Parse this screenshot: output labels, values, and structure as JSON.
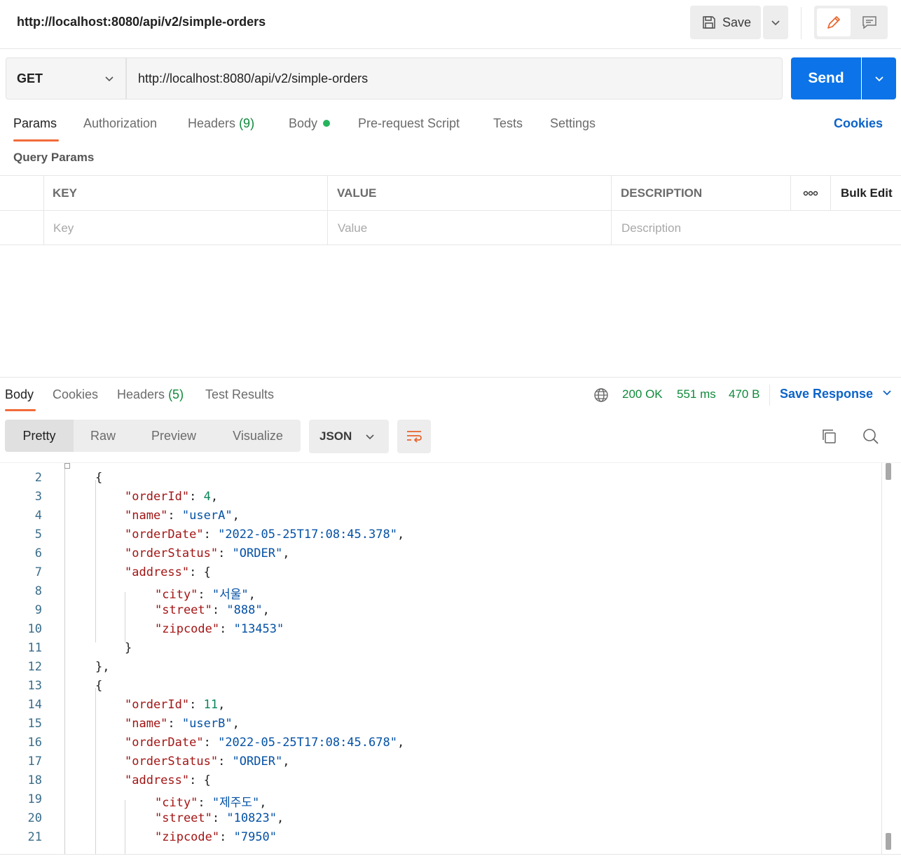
{
  "header": {
    "title": "http://localhost:8080/api/v2/simple-orders",
    "save_label": "Save"
  },
  "request": {
    "method": "GET",
    "url": "http://localhost:8080/api/v2/simple-orders",
    "send_label": "Send"
  },
  "req_tabs": {
    "params": "Params",
    "authorization": "Authorization",
    "headers": "Headers",
    "headers_count": "(9)",
    "body": "Body",
    "prerequest": "Pre-request Script",
    "tests": "Tests",
    "settings": "Settings",
    "cookies": "Cookies"
  },
  "query_params": {
    "title": "Query Params",
    "columns": {
      "key": "KEY",
      "value": "VALUE",
      "description": "DESCRIPTION",
      "bulk_edit": "Bulk Edit"
    },
    "placeholders": {
      "key": "Key",
      "value": "Value",
      "description": "Description"
    }
  },
  "response": {
    "tabs": {
      "body": "Body",
      "cookies": "Cookies",
      "headers": "Headers",
      "headers_count": "(5)",
      "test_results": "Test Results"
    },
    "status": "200 OK",
    "time": "551 ms",
    "size": "470 B",
    "save_response": "Save Response",
    "views": {
      "pretty": "Pretty",
      "raw": "Raw",
      "preview": "Preview",
      "visualize": "Visualize"
    },
    "format": "JSON"
  },
  "code_lines": [
    {
      "n": "2",
      "t": [
        [
          "p",
          "{"
        ]
      ]
    },
    {
      "n": "3",
      "t": [
        [
          "k",
          "\"orderId\""
        ],
        [
          "p",
          ": "
        ],
        [
          "n",
          "4"
        ],
        [
          "p",
          ","
        ]
      ]
    },
    {
      "n": "4",
      "t": [
        [
          "k",
          "\"name\""
        ],
        [
          "p",
          ": "
        ],
        [
          "s",
          "\"userA\""
        ],
        [
          "p",
          ","
        ]
      ]
    },
    {
      "n": "5",
      "t": [
        [
          "k",
          "\"orderDate\""
        ],
        [
          "p",
          ": "
        ],
        [
          "s",
          "\"2022-05-25T17:08:45.378\""
        ],
        [
          "p",
          ","
        ]
      ]
    },
    {
      "n": "6",
      "t": [
        [
          "k",
          "\"orderStatus\""
        ],
        [
          "p",
          ": "
        ],
        [
          "s",
          "\"ORDER\""
        ],
        [
          "p",
          ","
        ]
      ]
    },
    {
      "n": "7",
      "t": [
        [
          "k",
          "\"address\""
        ],
        [
          "p",
          ": {"
        ]
      ]
    },
    {
      "n": "8",
      "t": [
        [
          "k",
          "\"city\""
        ],
        [
          "p",
          ": "
        ],
        [
          "s",
          "\"서울\""
        ],
        [
          "p",
          ","
        ]
      ]
    },
    {
      "n": "9",
      "t": [
        [
          "k",
          "\"street\""
        ],
        [
          "p",
          ": "
        ],
        [
          "s",
          "\"888\""
        ],
        [
          "p",
          ","
        ]
      ]
    },
    {
      "n": "10",
      "t": [
        [
          "k",
          "\"zipcode\""
        ],
        [
          "p",
          ": "
        ],
        [
          "s",
          "\"13453\""
        ]
      ]
    },
    {
      "n": "11",
      "t": [
        [
          "p",
          "}"
        ]
      ]
    },
    {
      "n": "12",
      "t": [
        [
          "p",
          "},"
        ]
      ]
    },
    {
      "n": "13",
      "t": [
        [
          "p",
          "{"
        ]
      ]
    },
    {
      "n": "14",
      "t": [
        [
          "k",
          "\"orderId\""
        ],
        [
          "p",
          ": "
        ],
        [
          "n",
          "11"
        ],
        [
          "p",
          ","
        ]
      ]
    },
    {
      "n": "15",
      "t": [
        [
          "k",
          "\"name\""
        ],
        [
          "p",
          ": "
        ],
        [
          "s",
          "\"userB\""
        ],
        [
          "p",
          ","
        ]
      ]
    },
    {
      "n": "16",
      "t": [
        [
          "k",
          "\"orderDate\""
        ],
        [
          "p",
          ": "
        ],
        [
          "s",
          "\"2022-05-25T17:08:45.678\""
        ],
        [
          "p",
          ","
        ]
      ]
    },
    {
      "n": "17",
      "t": [
        [
          "k",
          "\"orderStatus\""
        ],
        [
          "p",
          ": "
        ],
        [
          "s",
          "\"ORDER\""
        ],
        [
          "p",
          ","
        ]
      ]
    },
    {
      "n": "18",
      "t": [
        [
          "k",
          "\"address\""
        ],
        [
          "p",
          ": {"
        ]
      ]
    },
    {
      "n": "19",
      "t": [
        [
          "k",
          "\"city\""
        ],
        [
          "p",
          ": "
        ],
        [
          "s",
          "\"제주도\""
        ],
        [
          "p",
          ","
        ]
      ]
    },
    {
      "n": "20",
      "t": [
        [
          "k",
          "\"street\""
        ],
        [
          "p",
          ": "
        ],
        [
          "s",
          "\"10823\""
        ],
        [
          "p",
          ","
        ]
      ]
    },
    {
      "n": "21",
      "t": [
        [
          "k",
          "\"zipcode\""
        ],
        [
          "p",
          ": "
        ],
        [
          "s",
          "\"7950\""
        ]
      ]
    }
  ],
  "colors": {
    "accent": "#0c73e8",
    "tab_underline": "#f26b3a",
    "status_ok": "#0f8a3a",
    "link": "#0c63c9"
  }
}
